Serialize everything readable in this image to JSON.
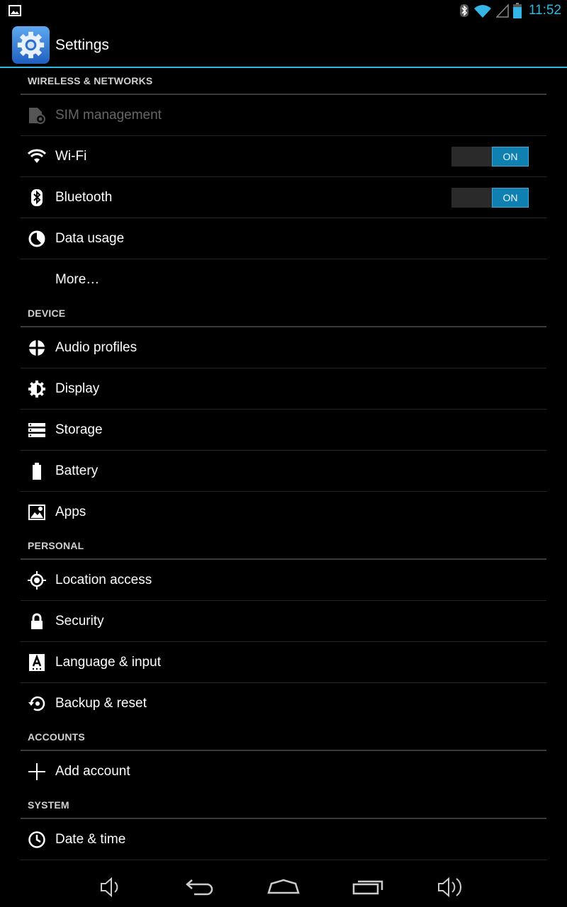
{
  "status_bar": {
    "time": "11:52",
    "icons": [
      "image-notification-icon",
      "bluetooth-icon",
      "wifi-icon",
      "signal-icon",
      "battery-icon"
    ]
  },
  "action_bar": {
    "title": "Settings",
    "app_icon": "settings-gear-icon"
  },
  "colors": {
    "accent": "#33b5e5",
    "toggle_on": "#0f80b0",
    "divider": "#3a3a3a"
  },
  "sections": {
    "wireless": {
      "header": "WIRELESS & NETWORKS",
      "sim": "SIM management",
      "wifi": "Wi-Fi",
      "wifi_toggle": "ON",
      "bluetooth": "Bluetooth",
      "bluetooth_toggle": "ON",
      "data_usage": "Data usage",
      "more": "More…"
    },
    "device": {
      "header": "DEVICE",
      "audio": "Audio profiles",
      "display": "Display",
      "storage": "Storage",
      "battery": "Battery",
      "apps": "Apps"
    },
    "personal": {
      "header": "PERSONAL",
      "location": "Location access",
      "security": "Security",
      "language": "Language & input",
      "backup": "Backup & reset"
    },
    "accounts": {
      "header": "ACCOUNTS",
      "add_account": "Add account"
    },
    "system": {
      "header": "SYSTEM",
      "date_time": "Date & time"
    }
  },
  "nav_bar": [
    "volume-down-icon",
    "back-icon",
    "home-icon",
    "recent-apps-icon",
    "volume-up-icon"
  ]
}
